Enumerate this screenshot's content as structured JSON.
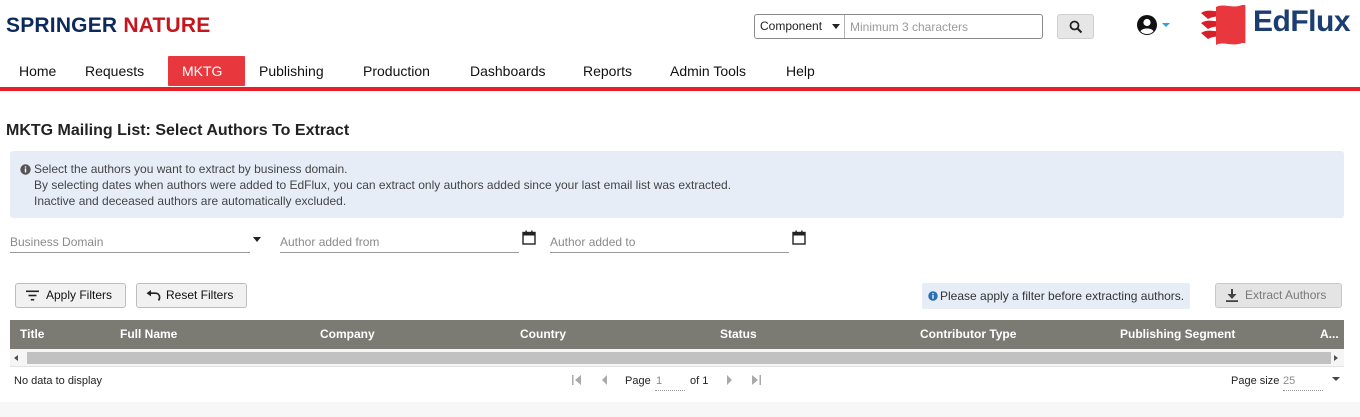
{
  "header": {
    "brand_left_1": "SPRINGER",
    "brand_left_2": "NATURE",
    "brand_right": "EdFlux",
    "search": {
      "scope_value": "Component",
      "placeholder": "Minimum 3 characters"
    }
  },
  "nav": {
    "items": [
      {
        "label": "Home"
      },
      {
        "label": "Requests"
      },
      {
        "label": "MKTG",
        "active": true
      },
      {
        "label": "Publishing"
      },
      {
        "label": "Production"
      },
      {
        "label": "Dashboards"
      },
      {
        "label": "Reports"
      },
      {
        "label": "Admin Tools"
      },
      {
        "label": "Help"
      }
    ]
  },
  "page": {
    "title": "MKTG Mailing List: Select Authors To Extract",
    "info": [
      "Select the authors you want to extract by business domain.",
      "By selecting dates when authors were added to EdFlux, you can extract only authors added since your last email list was extracted.",
      "Inactive and deceased authors are automatically excluded."
    ]
  },
  "filters": {
    "business_domain": "Business Domain",
    "added_from": "Author added from",
    "added_to": "Author added to",
    "apply_label": "Apply Filters",
    "reset_label": "Reset Filters",
    "notice": "Please apply a filter before extracting authors.",
    "extract_label": "Extract Authors"
  },
  "grid": {
    "columns": [
      "Title",
      "Full Name",
      "Company",
      "Country",
      "Status",
      "Contributor Type",
      "Publishing Segment",
      "A..."
    ],
    "empty_text": "No data to display",
    "page_label": "Page",
    "page_value": "1",
    "of_label": "of 1",
    "page_size_label": "Page size",
    "page_size_value": "25"
  },
  "colors": {
    "accent_red": "#e81f27",
    "active_tab": "#e8383e",
    "grid_header": "#7b7a73",
    "info_bg": "#e7edf7",
    "brand_navy": "#1c3d71"
  }
}
